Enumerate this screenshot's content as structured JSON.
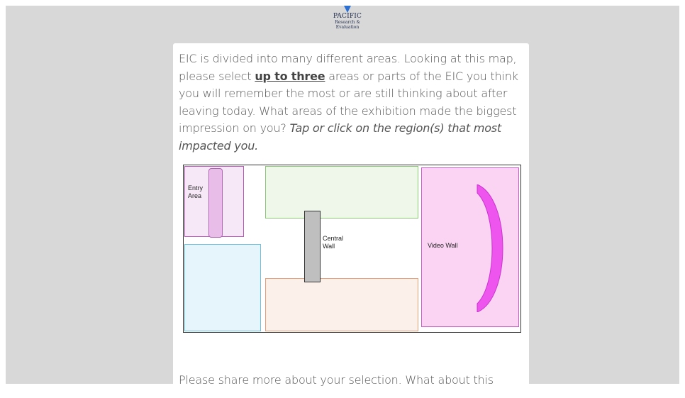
{
  "logo": {
    "name": "PACIFIC",
    "sub_line1": "Research &",
    "sub_line2": "Evaluation"
  },
  "question": {
    "text_before": "EIC is divided into many different areas. Looking at this map, please select ",
    "emphasis": "up to three",
    "text_after": " areas or parts of the EIC you think you will remember the most or are still thinking about after leaving today. What areas of the exhibition made the biggest impression on you? ",
    "instruction": "Tap or click on the region(s) that most impacted you."
  },
  "map": {
    "labels": {
      "entry": [
        "Entry",
        "Area"
      ],
      "central_wall": [
        "Central",
        "Wall"
      ],
      "video_wall": "Video Wall"
    },
    "colors": {
      "entry": "#f7e8f8",
      "green": "#eef7ea",
      "blue": "#e6f5fb",
      "orange": "#fcf1ea",
      "video": "#fbd4f4",
      "arc": "#ee55ee",
      "wall": "#bfbfbf"
    }
  },
  "followup": {
    "text": "Please share more about your selection. What about this"
  }
}
